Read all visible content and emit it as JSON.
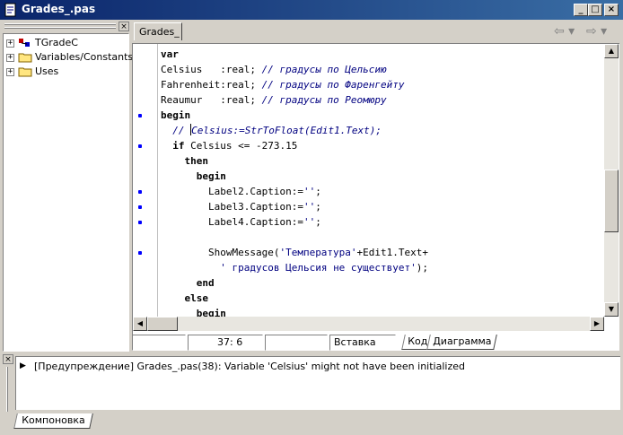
{
  "window": {
    "title": "Grades_.pas",
    "min_label": "_",
    "max_label": "□",
    "close_label": "×"
  },
  "tree": {
    "close_label": "×",
    "items": [
      {
        "expander": "+",
        "label": "TGradeC",
        "icon": "class-icon"
      },
      {
        "expander": "+",
        "label": "Variables/Constants",
        "icon": "folder-icon"
      },
      {
        "expander": "+",
        "label": "Uses",
        "icon": "folder-icon"
      }
    ]
  },
  "editor": {
    "tab_label": "Grades_",
    "nav_back": "⇦ ▾",
    "nav_forward": "⇨ ▾",
    "code_lines": [
      {
        "tokens": [
          {
            "t": "var",
            "c": "kw"
          }
        ],
        "dot": false
      },
      {
        "tokens": [
          {
            "t": "Celsius   :real; ",
            "c": ""
          },
          {
            "t": "// градусы по Цельсию",
            "c": "cm"
          }
        ],
        "dot": false
      },
      {
        "tokens": [
          {
            "t": "Fahrenheit:real; ",
            "c": ""
          },
          {
            "t": "// градусы по Фаренгейту",
            "c": "cm"
          }
        ],
        "dot": false
      },
      {
        "tokens": [
          {
            "t": "Reaumur   :real; ",
            "c": ""
          },
          {
            "t": "// градусы по Реомюру",
            "c": "cm"
          }
        ],
        "dot": false
      },
      {
        "tokens": [
          {
            "t": "begin",
            "c": "kw"
          }
        ],
        "dot": true
      },
      {
        "tokens": [
          {
            "t": "  // ",
            "c": "cm"
          },
          {
            "t": "",
            "c": "caret"
          },
          {
            "t": "Celsius:=StrToFloat(Edit1.Text);",
            "c": "cm"
          }
        ],
        "dot": false
      },
      {
        "tokens": [
          {
            "t": "  ",
            "c": ""
          },
          {
            "t": "if",
            "c": "kw"
          },
          {
            "t": " Celsius <= -273.15",
            "c": ""
          }
        ],
        "dot": true
      },
      {
        "tokens": [
          {
            "t": "    ",
            "c": ""
          },
          {
            "t": "then",
            "c": "kw"
          }
        ],
        "dot": false
      },
      {
        "tokens": [
          {
            "t": "      ",
            "c": ""
          },
          {
            "t": "begin",
            "c": "kw"
          }
        ],
        "dot": false
      },
      {
        "tokens": [
          {
            "t": "        Label2.Caption:=",
            "c": ""
          },
          {
            "t": "''",
            "c": "st"
          },
          {
            "t": ";",
            "c": ""
          }
        ],
        "dot": true
      },
      {
        "tokens": [
          {
            "t": "        Label3.Caption:=",
            "c": ""
          },
          {
            "t": "''",
            "c": "st"
          },
          {
            "t": ";",
            "c": ""
          }
        ],
        "dot": true
      },
      {
        "tokens": [
          {
            "t": "        Label4.Caption:=",
            "c": ""
          },
          {
            "t": "''",
            "c": "st"
          },
          {
            "t": ";",
            "c": ""
          }
        ],
        "dot": true
      },
      {
        "tokens": [
          {
            "t": "",
            "c": ""
          }
        ],
        "dot": false
      },
      {
        "tokens": [
          {
            "t": "        ShowMessage(",
            "c": ""
          },
          {
            "t": "'Температура'",
            "c": "st"
          },
          {
            "t": "+Edit1.Text+",
            "c": ""
          }
        ],
        "dot": true
      },
      {
        "tokens": [
          {
            "t": "          ",
            "c": ""
          },
          {
            "t": "' градусов Цельсия не существует'",
            "c": "st"
          },
          {
            "t": ");",
            "c": ""
          }
        ],
        "dot": false
      },
      {
        "tokens": [
          {
            "t": "      ",
            "c": ""
          },
          {
            "t": "end",
            "c": "kw"
          }
        ],
        "dot": false
      },
      {
        "tokens": [
          {
            "t": "    ",
            "c": ""
          },
          {
            "t": "else",
            "c": "kw"
          }
        ],
        "dot": false
      },
      {
        "tokens": [
          {
            "t": "      ",
            "c": ""
          },
          {
            "t": "begin",
            "c": "kw"
          }
        ],
        "dot": false
      }
    ]
  },
  "status": {
    "position": "37:  6",
    "mode": "Вставка",
    "tab_code": "Код",
    "tab_diagram": "Диаграмма"
  },
  "messages": {
    "close_label": "×",
    "arrow": "▶",
    "items": [
      "[Предупреждение] Grades_.pas(38): Variable 'Celsius' might not have been initialized"
    ],
    "tab_label": "Компоновка"
  },
  "colors": {
    "title_start": "#0a246a",
    "title_end": "#3a6ea5",
    "comment": "#000080",
    "breakpoint_dot": "#0000ff"
  }
}
